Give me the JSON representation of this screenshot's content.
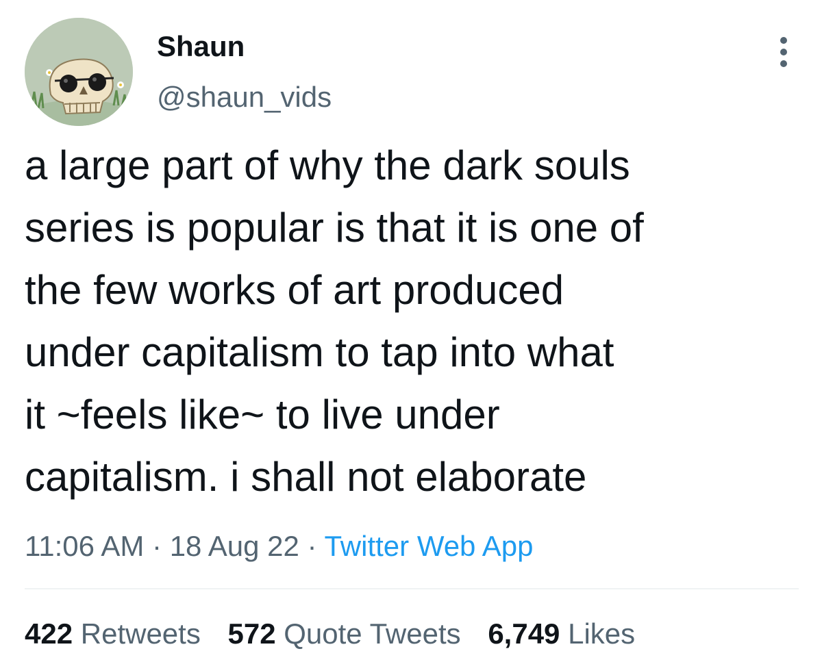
{
  "author": {
    "name": "Shaun",
    "handle": "@shaun_vids"
  },
  "tweet": {
    "lines": [
      "a large part of why the dark souls",
      "series is popular is that it is one of",
      "the few works of art produced",
      "under capitalism to tap into what",
      "it ~feels like~ to live under",
      "capitalism. i shall not elaborate"
    ],
    "time": "11:06 AM",
    "separator": "·",
    "date": "18 Aug 22",
    "source": "Twitter Web App"
  },
  "stats": {
    "retweets": {
      "count": "422",
      "label": "Retweets"
    },
    "quotes": {
      "count": "572",
      "label": "Quote Tweets"
    },
    "likes": {
      "count": "6,749",
      "label": "Likes"
    }
  },
  "colors": {
    "text": "#0f1419",
    "secondary": "#536471",
    "link": "#1d9bf0",
    "divider": "#eff3f4"
  },
  "icons": {
    "avatar": "skull-with-sunglasses-avatar",
    "more": "more-vertical-icon"
  }
}
